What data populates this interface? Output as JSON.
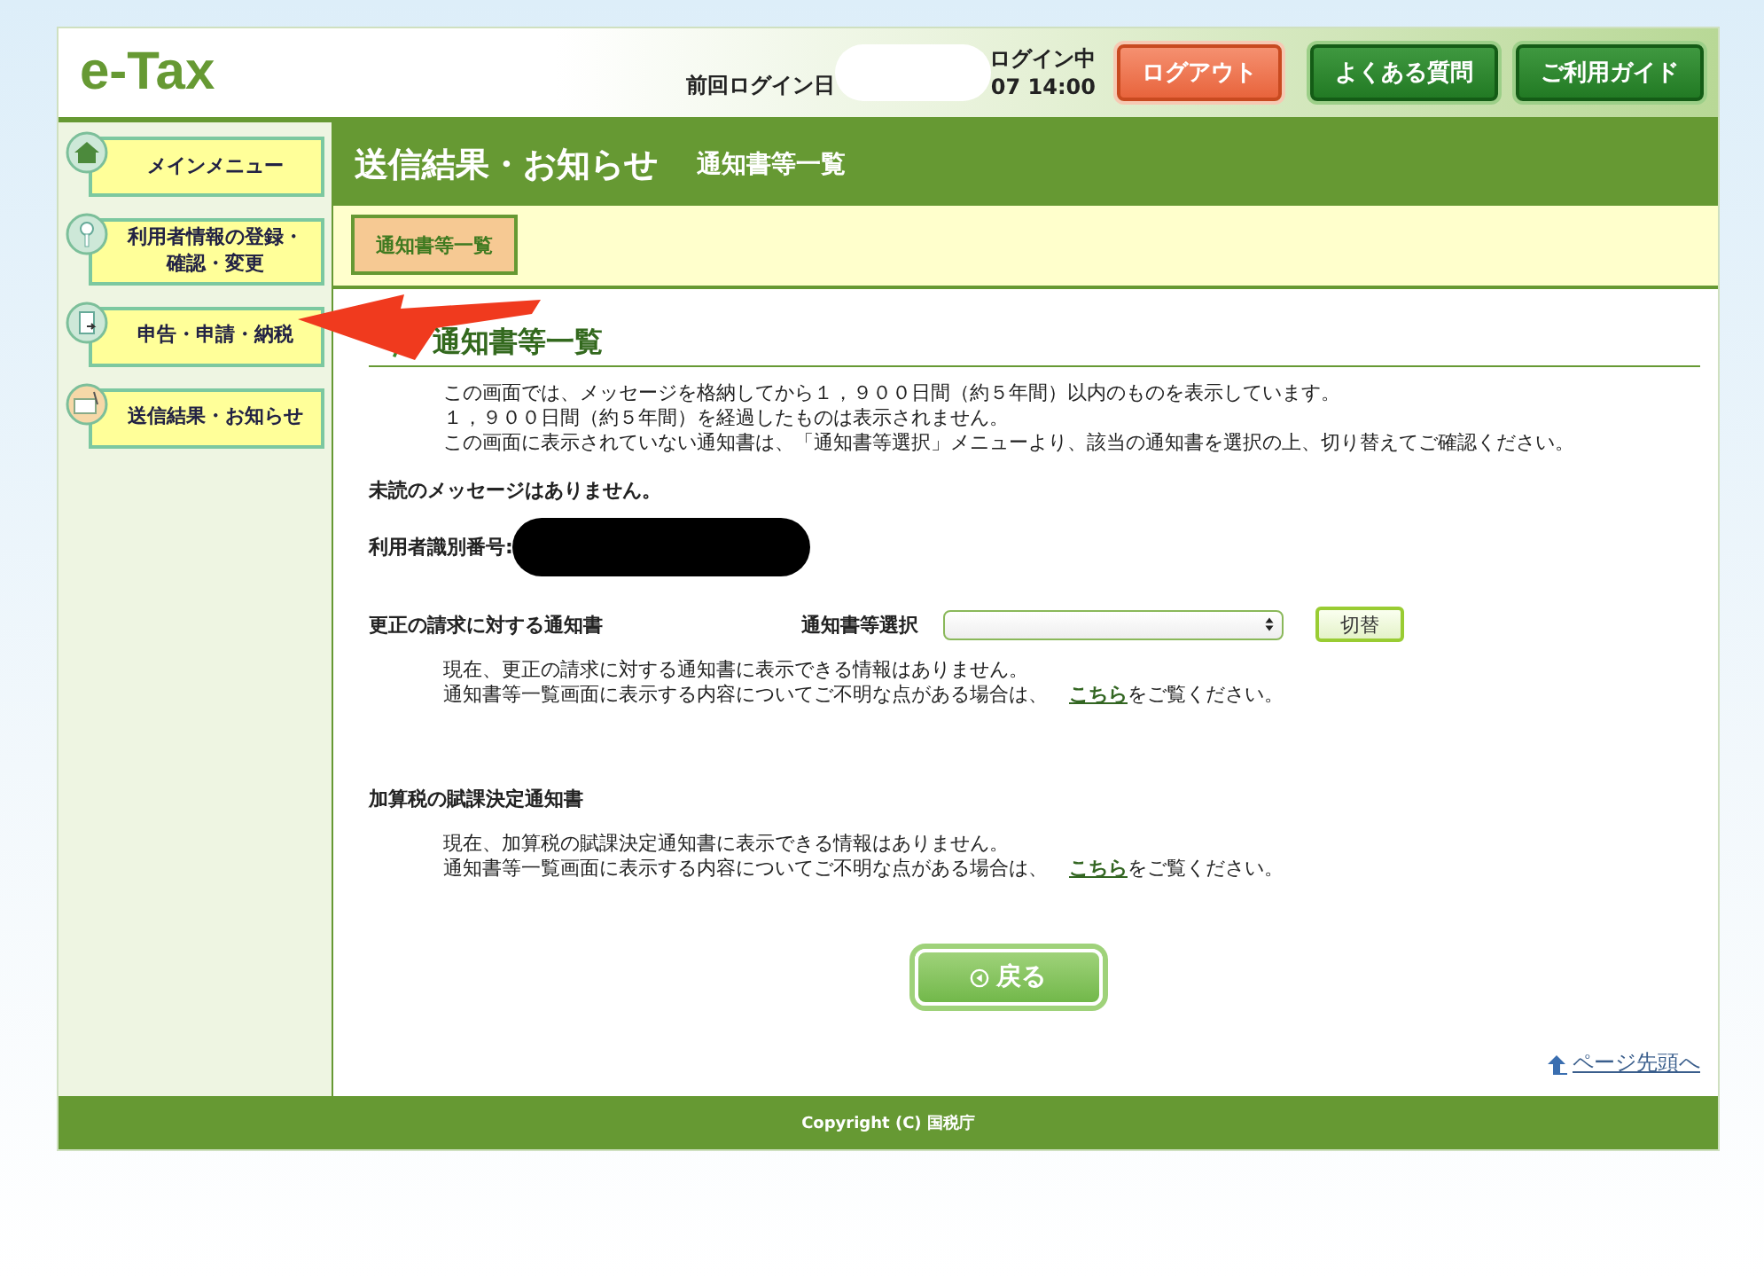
{
  "header": {
    "logo": "e-Tax",
    "login_status": "ログイン中",
    "last_login_label": "前回ログイン日",
    "last_login_time": "07 14:00",
    "buttons": [
      {
        "label": "ログアウト",
        "kind": "logout"
      },
      {
        "label": "よくある質問",
        "kind": "nav"
      },
      {
        "label": "ご利用ガイド",
        "kind": "nav"
      }
    ]
  },
  "sidebar": {
    "items": [
      {
        "lines": [
          "メインメニュー"
        ]
      },
      {
        "lines": [
          "利用者情報の登録・",
          "確認・変更"
        ]
      },
      {
        "lines": [
          "申告・申請・納税"
        ]
      },
      {
        "lines": [
          "送信結果・お知らせ"
        ]
      }
    ]
  },
  "page_title": "送信結果・お知らせ",
  "page_subtitle": "通知書等一覧",
  "tabs": [
    {
      "label": "通知書等一覧",
      "selected": true
    }
  ],
  "section_heading": "通知書等一覧",
  "intro_lines": [
    "この画面では、メッセージを格納してから１，９００日間（約５年間）以内のものを表示しています。",
    "１，９００日間（約５年間）を経過したものは表示されません。",
    "この画面に表示されていない通知書は、「通知書等選択」メニューより、該当の通知書を選択の上、切り替えてご確認ください。"
  ],
  "unread_notice": "未読のメッセージはありません。",
  "user_id_label": "利用者識別番号:",
  "notices": [
    {
      "title": "更正の請求に対する通知書",
      "select_label": "通知書等選択",
      "switch_button": "切替",
      "message": "現在、更正の請求に対する通知書に表示できる情報はありません。",
      "help_before": "通知書等一覧画面に表示する内容についてご不明な点がある場合は、",
      "help_link": "こちら",
      "help_after": "をご覧ください。"
    },
    {
      "title": "加算税の賦課決定通知書",
      "message": "現在、加算税の賦課決定通知書に表示できる情報はありません。",
      "help_before": "通知書等一覧画面に表示する内容についてご不明な点がある場合は、",
      "help_link": "こちら",
      "help_after": "をご覧ください。"
    }
  ],
  "back_button": "戻る",
  "page_top_link": "ページ先頭へ",
  "footer": "Copyright (C) 国税庁"
}
